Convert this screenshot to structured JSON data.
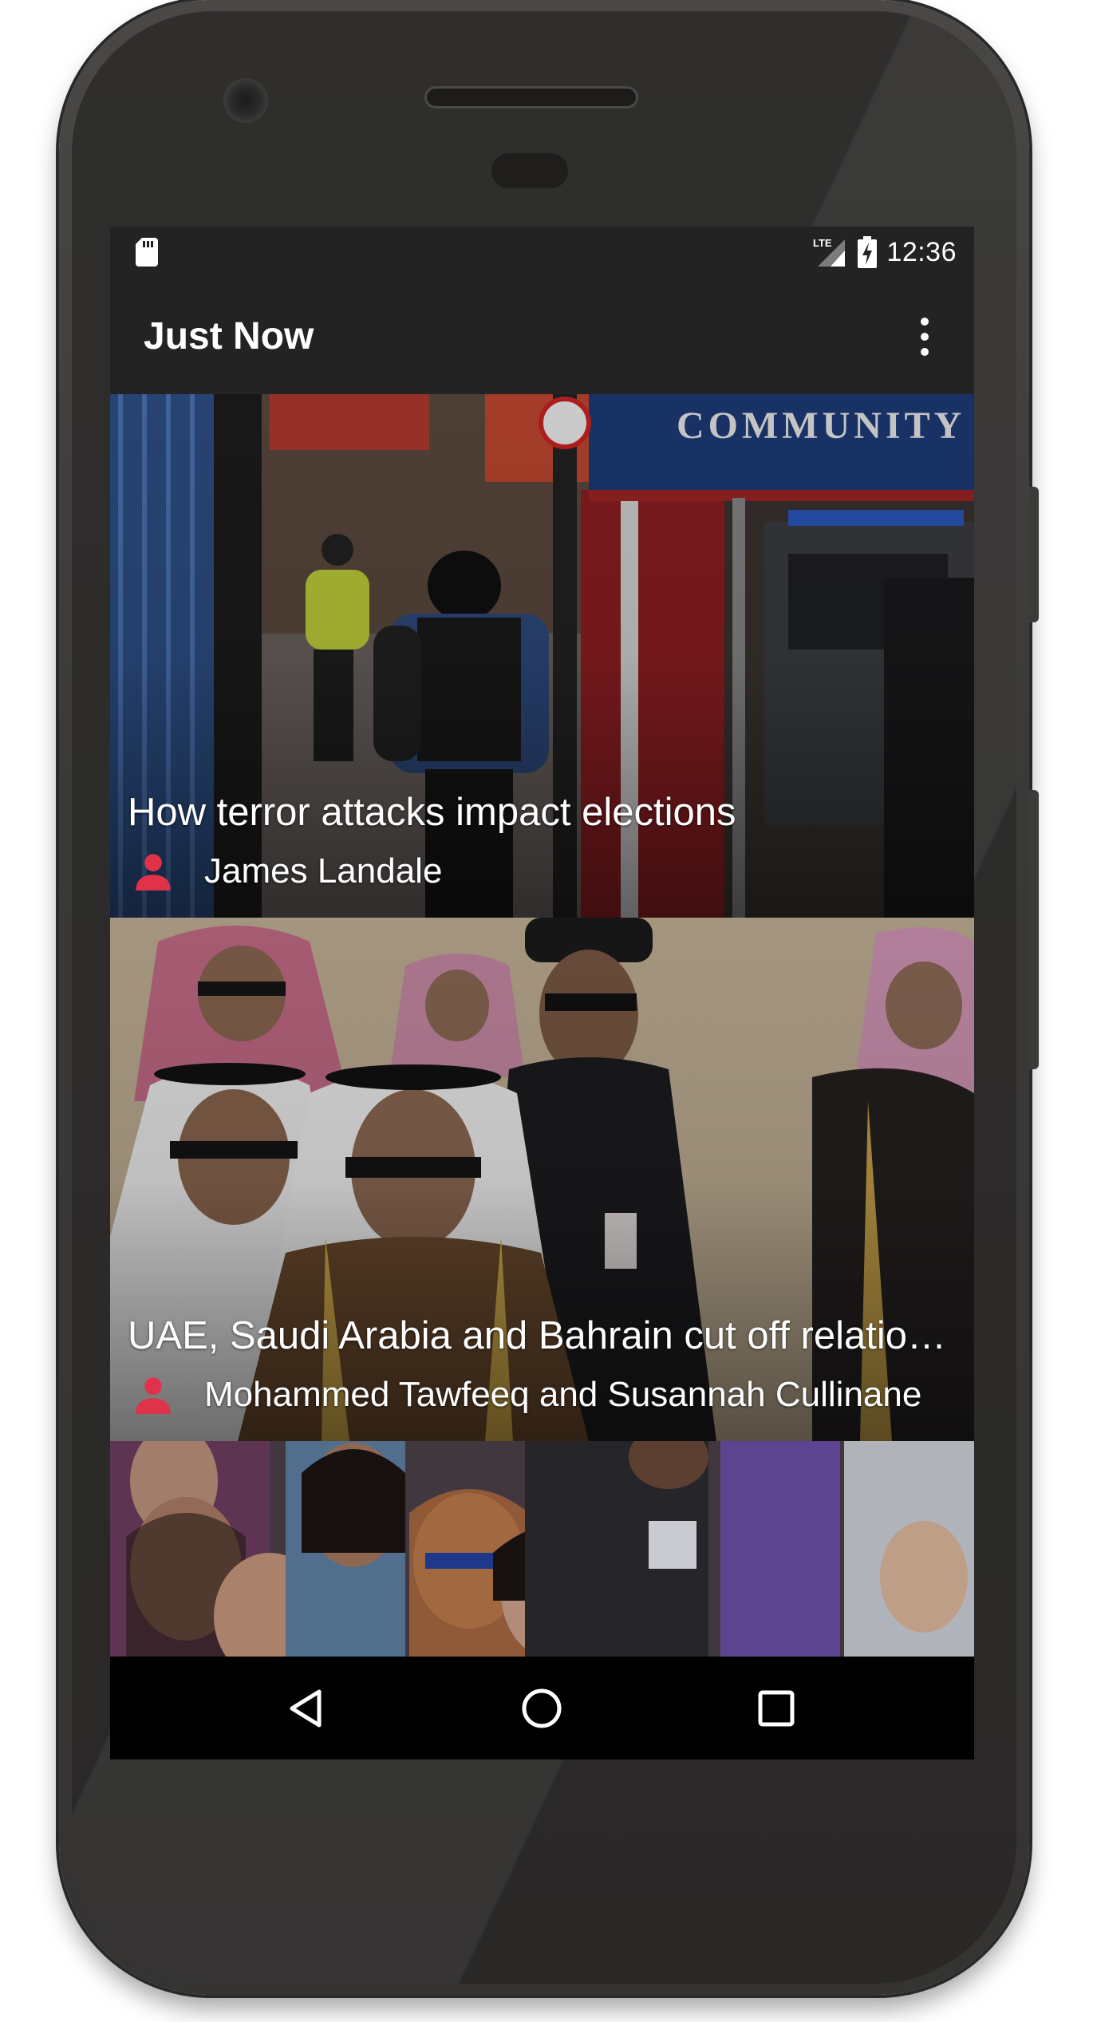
{
  "status_bar": {
    "time": "12:36",
    "network": "LTE",
    "icons": [
      "sd-card-icon",
      "lte-signal-icon",
      "battery-charging-icon"
    ]
  },
  "app_bar": {
    "title": "Just Now",
    "overflow_icon": "more-vert-icon"
  },
  "articles": [
    {
      "title": "How terror attacks impact elections",
      "author": "James Landale",
      "image": "armed-police-community-tent-photo",
      "author_icon_color": "#e0334a"
    },
    {
      "title": "UAE, Saudi Arabia and Bahrain cut off relations with Qatar",
      "author": "Mohammed Tawfeeq and Susannah Cullinane",
      "image": "saudi-officials-photo",
      "author_icon_color": "#e0334a"
    },
    {
      "title": "",
      "author": "",
      "image": "mourners-crowd-photo"
    }
  ],
  "nav_bar": {
    "buttons": [
      "back-icon",
      "home-icon",
      "recents-icon"
    ]
  }
}
